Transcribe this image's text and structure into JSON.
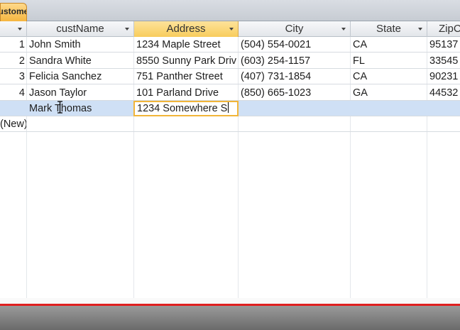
{
  "tab": {
    "label": "Customers"
  },
  "columns": [
    {
      "label": ""
    },
    {
      "label": "custName"
    },
    {
      "label": "Address"
    },
    {
      "label": "City"
    },
    {
      "label": "State"
    },
    {
      "label": "ZipC"
    }
  ],
  "rows": [
    {
      "id": "1",
      "name": "John Smith",
      "address": "1234 Maple Street",
      "city": "(504) 554-0021",
      "state": "CA",
      "zip": "95137"
    },
    {
      "id": "2",
      "name": "Sandra White",
      "address": "8550 Sunny Park Driv",
      "city": "(603) 254-1157",
      "state": "FL",
      "zip": "33545"
    },
    {
      "id": "3",
      "name": "Felicia Sanchez",
      "address": "751 Panther Street",
      "city": "(407) 731-1854",
      "state": "CA",
      "zip": "90231"
    },
    {
      "id": "4",
      "name": "Jason Taylor",
      "address": "101 Parland Drive",
      "city": "(850) 665-1023",
      "state": "GA",
      "zip": "44532"
    }
  ],
  "editing_row": {
    "name": "Mark Thomas",
    "address": "1234 Somewhere S"
  },
  "new_row": {
    "label": "(New)"
  },
  "colors": {
    "selected_header": "#f8cc5c",
    "current_row": "#cfe0f5",
    "red_line": "#e02020"
  }
}
